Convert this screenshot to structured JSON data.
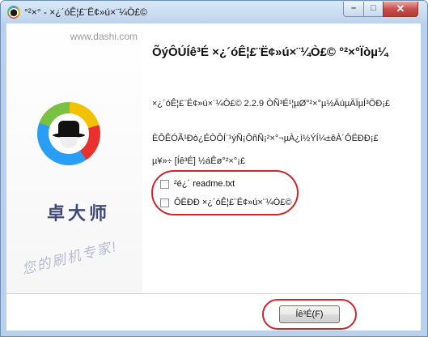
{
  "window": {
    "title": "°²×° - ×¿´óÊ¦£¨Ë¢»ú×¨¼Ò£©"
  },
  "sidebar": {
    "url": "www.dashi.com",
    "brand": "卓大师",
    "slogan": "您的刷机专家!"
  },
  "main": {
    "heading": "ÕýÔÚÍê³É ×¿´óÊ¦£¨Ë¢»ú×¨¼Ò£© °²×°Ïòµ¼",
    "para1": "×¿´óÊ¦£¨Ë¢»ú×¨¼Ò£© 2.2.9 ÒÑ³É¹¦µØ°²×°µ½ÄúµÄÏµÍ³ÖÐ¡£",
    "para2": "ÈÔÊÓÃ¹Ðò¿ÉÒÔÍ¨¹ýÑ¡ÔñÑ¡²×°¬µÀ¿ì½ÝÍ¼±êÀ´ÔËÐÐ¡£",
    "para3": "µ¥»÷ [Íê³É] ½áÊø°²×°¡£",
    "options": [
      {
        "label": "²é¿´ readme.txt",
        "checked": false
      },
      {
        "label": "ÔËÐÐ ×¿´óÊ¦£¨Ë¢»ú×¨¼Ò£©",
        "checked": false
      }
    ]
  },
  "footer": {
    "finish_button": "Íê³É(F)"
  },
  "colors": {
    "highlight": "#c9282d",
    "titlebar": "#bcd3ec"
  },
  "icons": [
    "app-logo-icon",
    "minimize-icon",
    "maximize-icon",
    "close-icon"
  ]
}
